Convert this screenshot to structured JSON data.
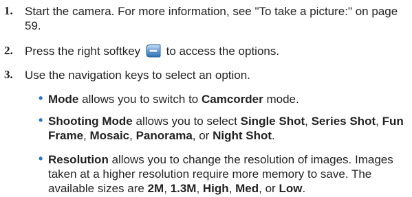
{
  "steps": [
    {
      "number": "1.",
      "text_a": "Start the camera. For more information, see \"To take a picture:\" on page",
      "text_b": "59."
    },
    {
      "number": "2.",
      "text_before": "Press the right softkey",
      "icon": "right-softkey-icon",
      "text_after": "to access the options."
    },
    {
      "number": "3.",
      "text": "Use the navigation keys to select an option."
    }
  ],
  "bullets": {
    "mode": {
      "term": "Mode",
      "text1": " allows you to switch to ",
      "term2": "Camcorder",
      "text2": " mode."
    },
    "shooting": {
      "term": "Shooting Mode",
      "text1": " allows you to select ",
      "opt1": "Single Shot",
      "sep1": ", ",
      "opt2": "Series Shot",
      "sep2": ", ",
      "opt3": "Fun Frame",
      "sep3": ", ",
      "opt4": "Mosaic",
      "sep4": ", ",
      "opt5": "Panorama",
      "sep5": ", or ",
      "opt6": "Night Shot",
      "end": "."
    },
    "resolution": {
      "term": "Resolution",
      "text1": " allows you to change the resolution of images. Images taken at a higher resolution require more memory to save. The available sizes are ",
      "s1": "2M",
      "sep1": ", ",
      "s2": "1.3M",
      "sep2": ", ",
      "s3": "High",
      "sep3": ", ",
      "s4": "Med",
      "sep4": ", or ",
      "s5": "Low",
      "end": "."
    }
  },
  "colors": {
    "bullet": "#2a6fd6",
    "text": "#222222"
  }
}
